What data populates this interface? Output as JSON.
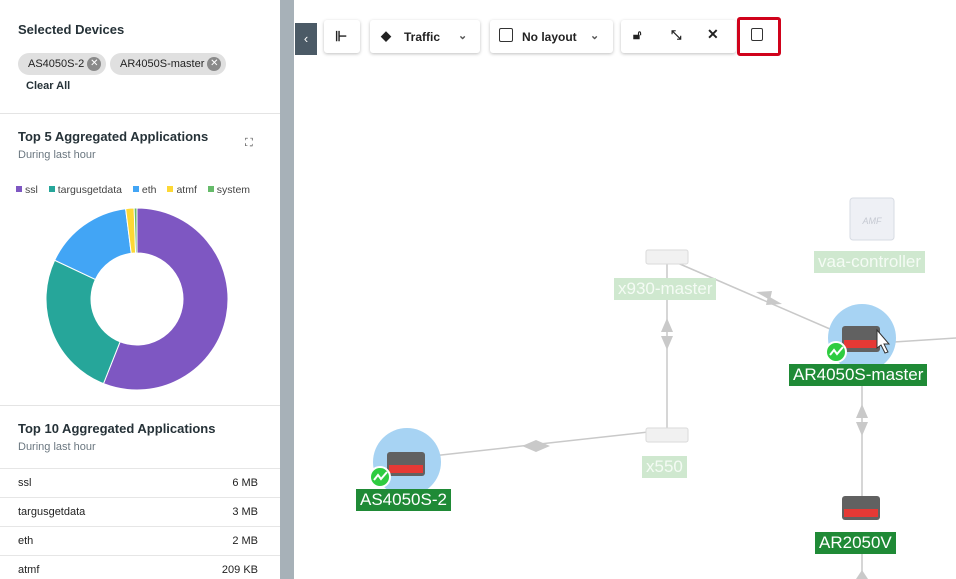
{
  "selected": {
    "title": "Selected Devices",
    "chips": [
      "AS4050S-2",
      "AR4050S-master"
    ],
    "clear_all": "Clear All"
  },
  "top5": {
    "title": "Top 5 Aggregated Applications",
    "subtitle": "During last hour",
    "expand_icon": "expand-icon",
    "legend": [
      "ssl",
      "targusgetdata",
      "eth",
      "atmf",
      "system"
    ]
  },
  "chart_data": {
    "type": "pie",
    "categories": [
      "ssl",
      "targusgetdata",
      "eth",
      "atmf",
      "system"
    ],
    "values": [
      56,
      26,
      16,
      1.5,
      0.5
    ],
    "colors": [
      "#7e57c2",
      "#26a69a",
      "#42a5f5",
      "#fdd835",
      "#66bb6a"
    ],
    "legend_position": "top"
  },
  "top10": {
    "title": "Top 10 Aggregated Applications",
    "subtitle": "During last hour",
    "rows": [
      {
        "name": "ssl",
        "value": "6 MB"
      },
      {
        "name": "targusgetdata",
        "value": "3 MB"
      },
      {
        "name": "eth",
        "value": "2 MB"
      },
      {
        "name": "atmf",
        "value": "209 KB"
      }
    ]
  },
  "toolbar": {
    "traffic_label": "Traffic",
    "layout_label": "No layout"
  },
  "graph": {
    "nodes": {
      "vaa_controller": "vaa-controller",
      "x930": "x930-master",
      "ar4050s": "AR4050S-master",
      "x550": "x550",
      "as4050s": "AS4050S-2",
      "ar2050v": "AR2050V"
    },
    "amf_logo": "AMF"
  }
}
